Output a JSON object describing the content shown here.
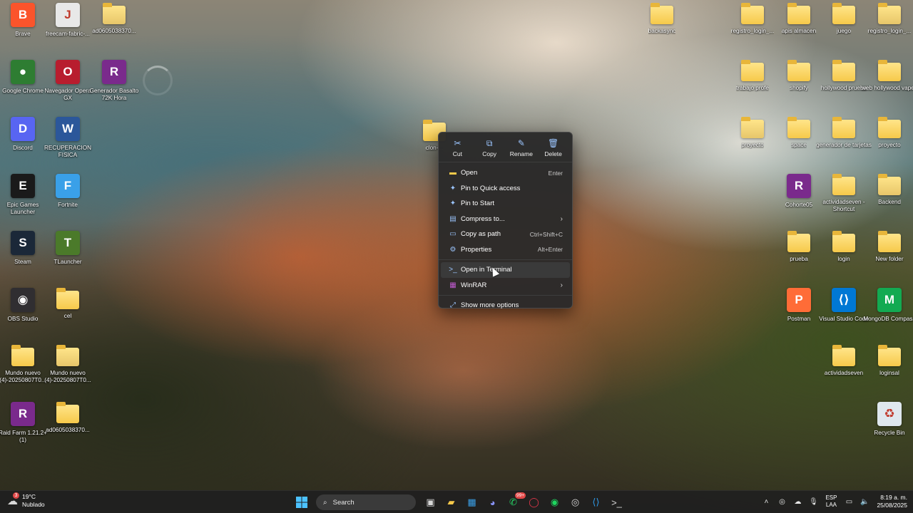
{
  "desktop": {
    "left_icons": [
      {
        "label": "Brave",
        "icon": "brave-icon",
        "glyph": "B",
        "color": "#fb542b"
      },
      {
        "label": "freecam-fabric-...",
        "icon": "java-icon",
        "glyph": "J",
        "color": "#e8e8e8"
      },
      {
        "label": "ad0605038370...",
        "icon": "zip-folder-icon",
        "glyph": "",
        "color": "#f6c94a"
      },
      {
        "label": "Google Chrome",
        "icon": "chrome-icon",
        "glyph": "●",
        "color": "#2e7d32"
      },
      {
        "label": "Navegador Opera GX",
        "icon": "opera-gx-icon",
        "glyph": "O",
        "color": "#b81d2e"
      },
      {
        "label": "Generador Basalto 72K Hora",
        "icon": "winrar-icon",
        "glyph": "R",
        "color": "#7a2a8c"
      },
      {
        "label": "Discord",
        "icon": "discord-icon",
        "glyph": "D",
        "color": "#5865f2"
      },
      {
        "label": "RECUPERACION FISICA",
        "icon": "word-icon",
        "glyph": "W",
        "color": "#2b579a"
      },
      {
        "label": "Epic Games Launcher",
        "icon": "epic-games-icon",
        "glyph": "E",
        "color": "#1a1a1a"
      },
      {
        "label": "Fortnite",
        "icon": "fortnite-icon",
        "glyph": "F",
        "color": "#3aa0e8"
      },
      {
        "label": "Steam",
        "icon": "steam-icon",
        "glyph": "S",
        "color": "#1b2838"
      },
      {
        "label": "TLauncher",
        "icon": "tlauncher-icon",
        "glyph": "T",
        "color": "#4b7a2a"
      },
      {
        "label": "OBS Studio",
        "icon": "obs-icon",
        "glyph": "◉",
        "color": "#302e31"
      },
      {
        "label": "cel",
        "icon": "folder-icon",
        "glyph": "",
        "color": "#f6c94a"
      },
      {
        "label": "Mundo nuevo (4)-20250807T0...",
        "icon": "folder-icon",
        "glyph": "",
        "color": "#f6c94a"
      },
      {
        "label": "Mundo nuevo (4)-20250807T0...",
        "icon": "zip-folder-icon",
        "glyph": "",
        "color": "#f6c94a"
      },
      {
        "label": "Raid Farm 1.21.2+ (1)",
        "icon": "winrar-icon",
        "glyph": "R",
        "color": "#7a2a8c"
      },
      {
        "label": "ad0605038370...",
        "icon": "folder-icon",
        "glyph": "",
        "color": "#f6c94a"
      }
    ],
    "right_icons": [
      {
        "label": "backasync",
        "icon": "folder-icon",
        "glyph": "",
        "color": "#f6c94a"
      },
      {
        "label": "registro_login_...",
        "icon": "folder-icon",
        "glyph": "",
        "color": "#f6c94a"
      },
      {
        "label": "apis almacen",
        "icon": "folder-icon",
        "glyph": "",
        "color": "#f6c94a"
      },
      {
        "label": "juego",
        "icon": "folder-icon",
        "glyph": "",
        "color": "#f6c94a"
      },
      {
        "label": "registro_login_...",
        "icon": "zip-folder-icon",
        "glyph": "",
        "color": "#f6c94a"
      },
      {
        "label": "trabajo profe",
        "icon": "folder-icon",
        "glyph": "",
        "color": "#f6c94a"
      },
      {
        "label": "shopify",
        "icon": "folder-icon",
        "glyph": "",
        "color": "#f6c94a"
      },
      {
        "label": "hollywood prueba",
        "icon": "folder-icon",
        "glyph": "",
        "color": "#f6c94a"
      },
      {
        "label": "web hollywood vapes",
        "icon": "folder-icon",
        "glyph": "",
        "color": "#f6c94a"
      },
      {
        "label": "proyecto",
        "icon": "zip-folder-icon",
        "glyph": "",
        "color": "#f6c94a"
      },
      {
        "label": "space",
        "icon": "folder-icon",
        "glyph": "",
        "color": "#f6c94a"
      },
      {
        "label": "generador de tarjetas",
        "icon": "folder-icon",
        "glyph": "",
        "color": "#f6c94a"
      },
      {
        "label": "proyecto",
        "icon": "folder-icon",
        "glyph": "",
        "color": "#f6c94a"
      },
      {
        "label": "Cohorte05",
        "icon": "winrar-icon",
        "glyph": "R",
        "color": "#7a2a8c"
      },
      {
        "label": "actividadseven - Shortcut",
        "icon": "folder-icon",
        "glyph": "",
        "color": "#f6c94a"
      },
      {
        "label": "Backend",
        "icon": "zip-folder-icon",
        "glyph": "",
        "color": "#f6c94a"
      },
      {
        "label": "prueba",
        "icon": "folder-icon",
        "glyph": "",
        "color": "#f6c94a"
      },
      {
        "label": "login",
        "icon": "folder-icon",
        "glyph": "",
        "color": "#f6c94a"
      },
      {
        "label": "New folder",
        "icon": "folder-icon",
        "glyph": "",
        "color": "#f6c94a"
      },
      {
        "label": "Postman",
        "icon": "postman-icon",
        "glyph": "P",
        "color": "#ff6c37"
      },
      {
        "label": "Visual Studio Code",
        "icon": "vscode-icon",
        "glyph": "⟨⟩",
        "color": "#0078d4"
      },
      {
        "label": "MongoDB Compass",
        "icon": "mongodb-icon",
        "glyph": "M",
        "color": "#13aa52"
      },
      {
        "label": "actividadseven",
        "icon": "folder-icon",
        "glyph": "",
        "color": "#f6c94a"
      },
      {
        "label": "loginsal",
        "icon": "folder-icon",
        "glyph": "",
        "color": "#f6c94a"
      },
      {
        "label": "Recycle Bin",
        "icon": "recycle-bin-icon",
        "glyph": "♻",
        "color": "#dfe8ee"
      }
    ],
    "selected_folder_label": "clon-..."
  },
  "context_menu": {
    "quick_actions": [
      {
        "label": "Cut",
        "icon": "cut-icon",
        "glyph": "✂"
      },
      {
        "label": "Copy",
        "icon": "copy-icon",
        "glyph": "⧉"
      },
      {
        "label": "Rename",
        "icon": "rename-icon",
        "glyph": "✎"
      },
      {
        "label": "Delete",
        "icon": "delete-icon",
        "glyph": "🗑"
      }
    ],
    "items": [
      {
        "label": "Open",
        "shortcut": "Enter",
        "icon": "folder-open-icon",
        "glyph": "▬"
      },
      {
        "label": "Pin to Quick access",
        "shortcut": "",
        "icon": "pin-icon",
        "glyph": "✦"
      },
      {
        "label": "Pin to Start",
        "shortcut": "",
        "icon": "pin-start-icon",
        "glyph": "✦"
      },
      {
        "label": "Compress to...",
        "shortcut": "",
        "icon": "compress-icon",
        "glyph": "▤",
        "submenu": true
      },
      {
        "label": "Copy as path",
        "shortcut": "Ctrl+Shift+C",
        "icon": "copy-path-icon",
        "glyph": "▭"
      },
      {
        "label": "Properties",
        "shortcut": "Alt+Enter",
        "icon": "properties-icon",
        "glyph": "⚙"
      }
    ],
    "items2": [
      {
        "label": "Open in Terminal",
        "shortcut": "",
        "icon": "terminal-icon",
        "glyph": ">_"
      },
      {
        "label": "WinRAR",
        "shortcut": "",
        "icon": "winrar-icon",
        "glyph": "▦",
        "submenu": true
      }
    ],
    "more": {
      "label": "Show more options",
      "icon": "show-more-icon",
      "glyph": "⤢"
    }
  },
  "taskbar": {
    "weather": {
      "temp": "19°C",
      "condition": "Nublado",
      "badge": "3"
    },
    "search_placeholder": "Search",
    "apps": [
      {
        "name": "task-view",
        "icon": "task-view-icon",
        "glyph": "▣"
      },
      {
        "name": "file-explorer",
        "icon": "file-explorer-icon",
        "glyph": "▰"
      },
      {
        "name": "microsoft-store",
        "icon": "store-icon",
        "glyph": "▦"
      },
      {
        "name": "discord",
        "icon": "discord-icon",
        "glyph": "◕"
      },
      {
        "name": "whatsapp",
        "icon": "whatsapp-icon",
        "glyph": "✆",
        "badge": "99+"
      },
      {
        "name": "opera-gx",
        "icon": "opera-gx-icon",
        "glyph": "◯"
      },
      {
        "name": "spotify",
        "icon": "spotify-icon",
        "glyph": "◉"
      },
      {
        "name": "obs-studio",
        "icon": "obs-icon",
        "glyph": "◎"
      },
      {
        "name": "vscode",
        "icon": "vscode-icon",
        "glyph": "⟨⟩"
      },
      {
        "name": "terminal",
        "icon": "terminal-icon",
        "glyph": ">_"
      }
    ],
    "tray": {
      "lang_top": "ESP",
      "lang_bottom": "LAA",
      "time": "8:19 a. m.",
      "date": "25/08/2025"
    }
  }
}
